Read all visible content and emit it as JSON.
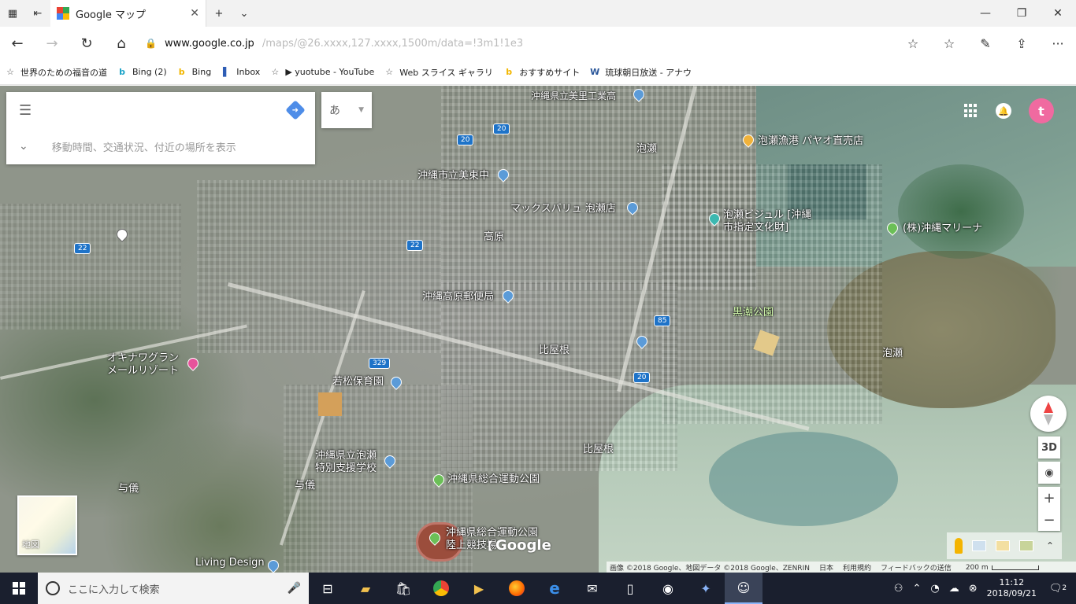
{
  "window": {
    "tab_title": "Google マップ",
    "new_tab_label": "+",
    "tab_list_label": "⌄",
    "minimize": "—",
    "maximize": "❐",
    "close": "✕"
  },
  "address": {
    "domain": "www.google.co.jp",
    "path": "/maps/@26.xxxx,127.xxxx,1500m/data=!3m1!1e3",
    "back": "←",
    "forward": "→",
    "refresh": "↻",
    "home": "⌂",
    "favorite": "☆",
    "favorites_list": "☆",
    "notes": "✎",
    "share": "⇪",
    "more": "···"
  },
  "favorites": [
    {
      "label": "世界のための福音の道",
      "icon": "☆",
      "color": "#555"
    },
    {
      "label": "Bing (2)",
      "icon": "b",
      "color": "#1aa3c8"
    },
    {
      "label": "Bing",
      "icon": "b",
      "color": "#f2b600"
    },
    {
      "label": "Inbox",
      "icon": "▌",
      "color": "#2e5db5"
    },
    {
      "label": "▶ yuotube - YouTube",
      "icon": "☆",
      "color": "#555"
    },
    {
      "label": "Web スライス ギャラリー",
      "icon": "☆",
      "color": "#555"
    },
    {
      "label": "おすすめサイト",
      "icon": "b",
      "color": "#f2b600"
    },
    {
      "label": "琉球朝日放送 - アナウ",
      "icon": "W",
      "color": "#2b579a"
    }
  ],
  "search": {
    "placeholder": "",
    "subtext": "移動時間、交通状況、付近の場所を表示",
    "ime": "あ"
  },
  "map_labels": {
    "l1": "沖縄県立美里工業高",
    "l2": "泡瀬",
    "l3": "泡瀬漁港 パヤオ直売店",
    "l4": "沖縄市立美東中",
    "l5": "マックスバリュ 泡瀬店",
    "l6": "泡瀬ビジュル [沖縄",
    "l6b": "市指定文化財]",
    "l7": "(株)沖縄マリーナ",
    "l8": "高原",
    "l9": "沖縄高原郵便局",
    "l10": "黒潮公園",
    "l11": "比屋根",
    "l12": "泡瀬",
    "l13": "オキナワグラン",
    "l13b": "メールリゾート",
    "l14": "若松保育園",
    "l15": "比屋根",
    "l16": "沖縄県立泡瀬",
    "l16b": "特別支援学校",
    "l17": "沖縄県総合運動公園",
    "l18": "与儀",
    "l19": "与儀",
    "l20": "沖縄県総合運動公園",
    "l20b": "陸上競技場",
    "l21": "Living Design"
  },
  "road_shields": {
    "r20a": "20",
    "r20b": "20",
    "r22a": "22",
    "r22b": "22",
    "r85": "85",
    "r329": "329",
    "r20c": "20"
  },
  "controls": {
    "three_d": "3D",
    "locate": "◉",
    "zoom_in": "+",
    "zoom_out": "−",
    "minimap_label": "地図",
    "google_logo": "Google",
    "avatar_letter": "t",
    "expand": "⌃"
  },
  "attribution": {
    "imagery": "画像 ©2018 Google、地図データ ©2018 Google、ZENRIN",
    "country": "日本",
    "terms": "利用規約",
    "feedback": "フィードバックの送信",
    "scale": "200 m"
  },
  "taskbar": {
    "search_placeholder": "ここに入力して検索",
    "time": "11:12",
    "date": "2018/09/21",
    "notifications": "2"
  }
}
